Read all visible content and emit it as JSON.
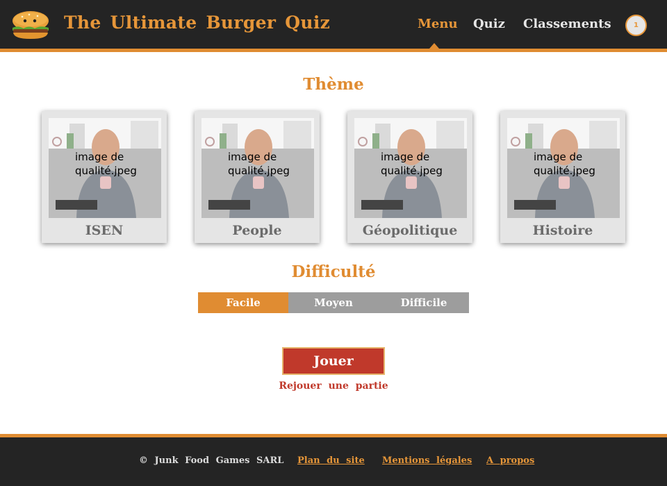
{
  "header": {
    "logo_icon": "burger-icon",
    "brand": "The Ultimate Burger Quiz",
    "nav": [
      {
        "label": "Menu",
        "active": true
      },
      {
        "label": "Quiz",
        "active": false
      },
      {
        "label": "Classements",
        "active": false
      }
    ],
    "avatar_badge": "1"
  },
  "theme": {
    "title": "Thème",
    "cards": [
      {
        "label": "ISEN",
        "image_caption": "image de qualité.jpeg"
      },
      {
        "label": "People",
        "image_caption": "image de qualité.jpeg"
      },
      {
        "label": "Géopolitique",
        "image_caption": "image de qualité.jpeg"
      },
      {
        "label": "Histoire",
        "image_caption": "image de qualité.jpeg"
      }
    ]
  },
  "difficulty": {
    "title": "Difficulté",
    "options": [
      "Facile",
      "Moyen",
      "Difficile"
    ],
    "selected": "Facile"
  },
  "actions": {
    "play_label": "Jouer",
    "replay_label": "Rejouer une partie"
  },
  "footer": {
    "copyright": "© Junk Food Games SARL",
    "links": [
      "Plan du site",
      "Mentions légales",
      "A propos"
    ]
  },
  "colors": {
    "accent": "#e08c32",
    "header_bg": "#242424",
    "play_button": "#c0392b",
    "difficulty_inactive": "#9d9d9d"
  }
}
